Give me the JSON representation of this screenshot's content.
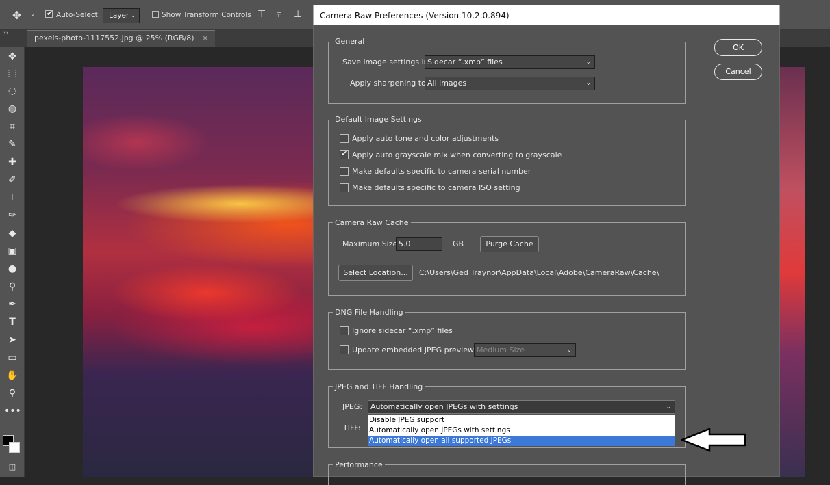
{
  "options_bar": {
    "auto_select_label": "Auto-Select:",
    "layer_select": "Layer",
    "show_transform_label": "Show Transform Controls"
  },
  "document_tab": {
    "title": "pexels-photo-1117552.jpg @ 25% (RGB/8)",
    "close": "×"
  },
  "dialog": {
    "title": "Camera Raw Preferences  (Version 10.2.0.894)",
    "ok_label": "OK",
    "cancel_label": "Cancel",
    "general": {
      "legend": "General",
      "save_label": "Save image settings in:",
      "save_value": "Sidecar “.xmp” files",
      "sharpen_label": "Apply sharpening to:",
      "sharpen_value": "All images"
    },
    "defaults": {
      "legend": "Default Image Settings",
      "items": [
        {
          "label": "Apply auto tone and color adjustments",
          "checked": false
        },
        {
          "label": "Apply auto grayscale mix when converting to grayscale",
          "checked": true
        },
        {
          "label": "Make defaults specific to camera serial number",
          "checked": false
        },
        {
          "label": "Make defaults specific to camera ISO setting",
          "checked": false
        }
      ]
    },
    "cache": {
      "legend": "Camera Raw Cache",
      "max_label": "Maximum Size:",
      "max_value": "5.0",
      "unit": "GB",
      "purge_label": "Purge Cache",
      "select_label": "Select Location...",
      "path": "C:\\Users\\Ged Traynor\\AppData\\Local\\Adobe\\CameraRaw\\Cache\\"
    },
    "dng": {
      "legend": "DNG File Handling",
      "ignore_label": "Ignore sidecar “.xmp” files",
      "update_label": "Update embedded JPEG previews:",
      "preview_value": "Medium Size"
    },
    "jpeg_tiff": {
      "legend": "JPEG and TIFF Handling",
      "jpeg_label": "JPEG:",
      "jpeg_value": "Automatically open JPEGs with settings",
      "tiff_label": "TIFF:",
      "options": [
        "Disable JPEG support",
        "Automatically open JPEGs with settings",
        "Automatically open all supported JPEGs"
      ],
      "highlighted_index": 2
    },
    "performance": {
      "legend": "Performance"
    }
  },
  "colors": {
    "highlight": "#3b78d8",
    "panel": "#535353"
  }
}
